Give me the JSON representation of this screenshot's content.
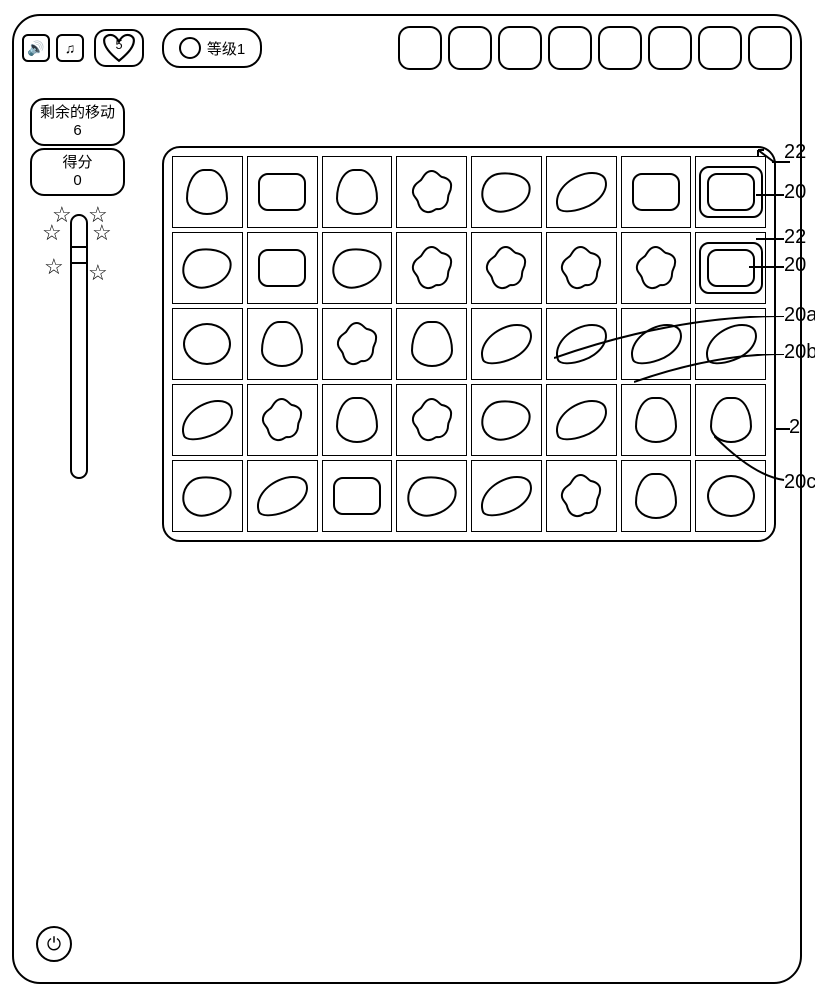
{
  "topbar": {
    "sound_icon": "🔊",
    "music_icon": "♫",
    "lives": "5",
    "level_label": "等级1",
    "tool_count": 8
  },
  "stats": {
    "moves_label": "剩余的移动",
    "moves_value": "6",
    "score_label": "得分",
    "score_value": "0"
  },
  "progress": {
    "star_count": 6
  },
  "board": {
    "rows": 5,
    "cols": 8,
    "grid": [
      [
        "drop",
        "pillow",
        "drop",
        "flower",
        "lemon",
        "bean",
        "pillow",
        "pillow"
      ],
      [
        "lemon",
        "pillow",
        "lemon",
        "flower",
        "flower",
        "flower",
        "flower",
        "pillow"
      ],
      [
        "oval",
        "drop",
        "flower",
        "drop",
        "bean",
        "bean",
        "bean",
        "bean"
      ],
      [
        "bean",
        "flower",
        "drop",
        "flower",
        "lemon",
        "bean",
        "drop",
        "drop"
      ],
      [
        "lemon",
        "bean",
        "pillow",
        "lemon",
        "bean",
        "flower",
        "drop",
        "oval"
      ]
    ],
    "special_cells": [
      [
        0,
        7
      ],
      [
        1,
        7
      ]
    ]
  },
  "annotations": {
    "a1_top": "22",
    "a1_bottom": "20",
    "a2_top": "22",
    "a2_bottom": "20",
    "a3": "20a",
    "a4": "20b",
    "a5": "2",
    "a6": "20c"
  },
  "power_glyph": "⏻"
}
